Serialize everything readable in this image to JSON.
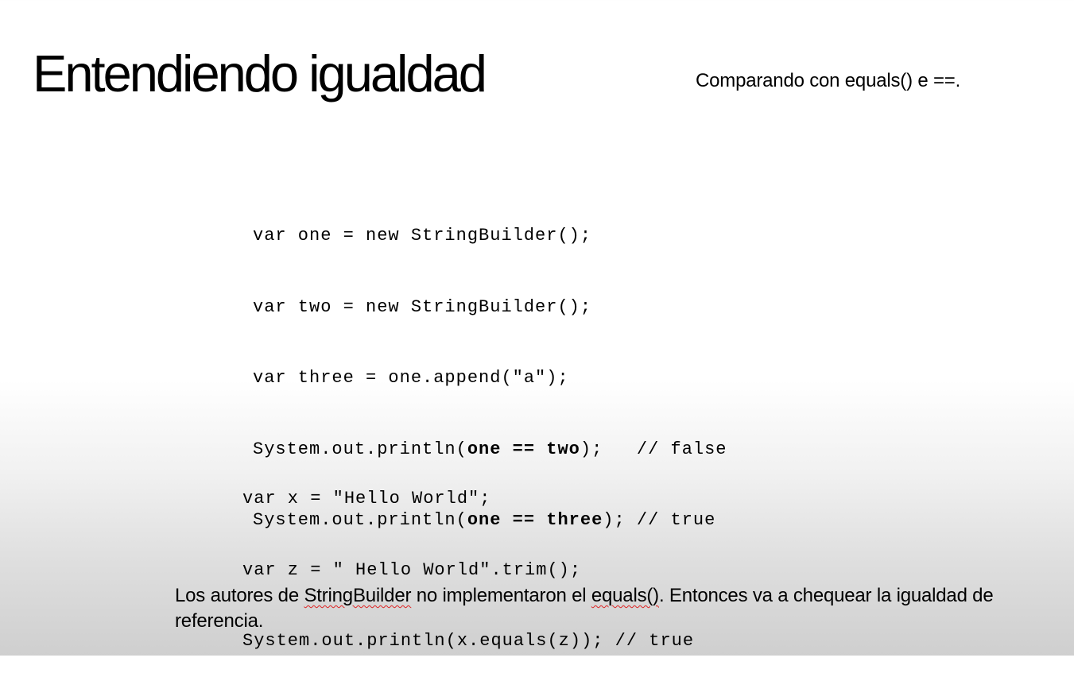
{
  "slide": {
    "title": "Entendiendo igualdad",
    "subtitle": "Comparando con equals() e ==."
  },
  "code_block_1": {
    "line1": "var one = new StringBuilder();",
    "line2": "var two = new StringBuilder();",
    "line3": "var three = one.append(\"a\");",
    "line4": {
      "start": "System.out.println(",
      "bold": "one == two",
      "end": ");   // false"
    },
    "line5": {
      "start": "System.out.println(",
      "bold": "one == three",
      "end": "); // true"
    }
  },
  "code_block_2": {
    "line1": "var x = \"Hello World\";",
    "line2": "var z = \" Hello World\".trim();",
    "line3": "System.out.println(x.equals(z)); // true"
  },
  "note": {
    "part1": "Los autores de ",
    "word1": "StringBuilder",
    "part2": " no implementaron el ",
    "word2": "equals()",
    "part3": ". Entonces va a chequear la igualdad de referencia."
  },
  "colors": {
    "text": "#000000",
    "spellcheck_underline": "#d22222",
    "background_top": "#ffffff",
    "background_bottom": "#cfcfcf"
  }
}
